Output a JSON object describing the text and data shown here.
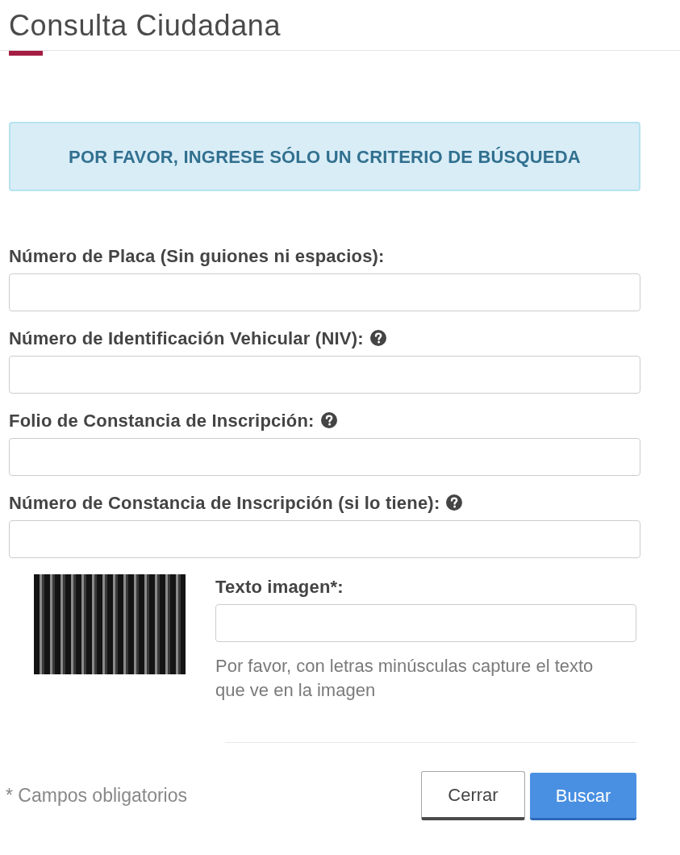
{
  "page": {
    "title": "Consulta Ciudadana"
  },
  "alert": {
    "text": "POR FAVOR, INGRESE SÓLO UN CRITERIO DE BÚSQUEDA"
  },
  "fields": [
    {
      "label": "Número de Placa (Sin guiones ni espacios):",
      "help": false
    },
    {
      "label": "Número de Identificación Vehicular (NIV):",
      "help": true
    },
    {
      "label": "Folio de Constancia de Inscripción:",
      "help": true
    },
    {
      "label": "Número de Constancia de Inscripción (si lo tiene):",
      "help": true
    }
  ],
  "captcha": {
    "label": "Texto imagen*:",
    "hint": "Por favor, con letras minúsculas capture el texto que ve en la imagen"
  },
  "footer": {
    "note": "* Campos obligatorios",
    "buttons": [
      {
        "label": "Cerrar",
        "kind": "secondary"
      },
      {
        "label": "Buscar",
        "kind": "primary"
      }
    ]
  }
}
